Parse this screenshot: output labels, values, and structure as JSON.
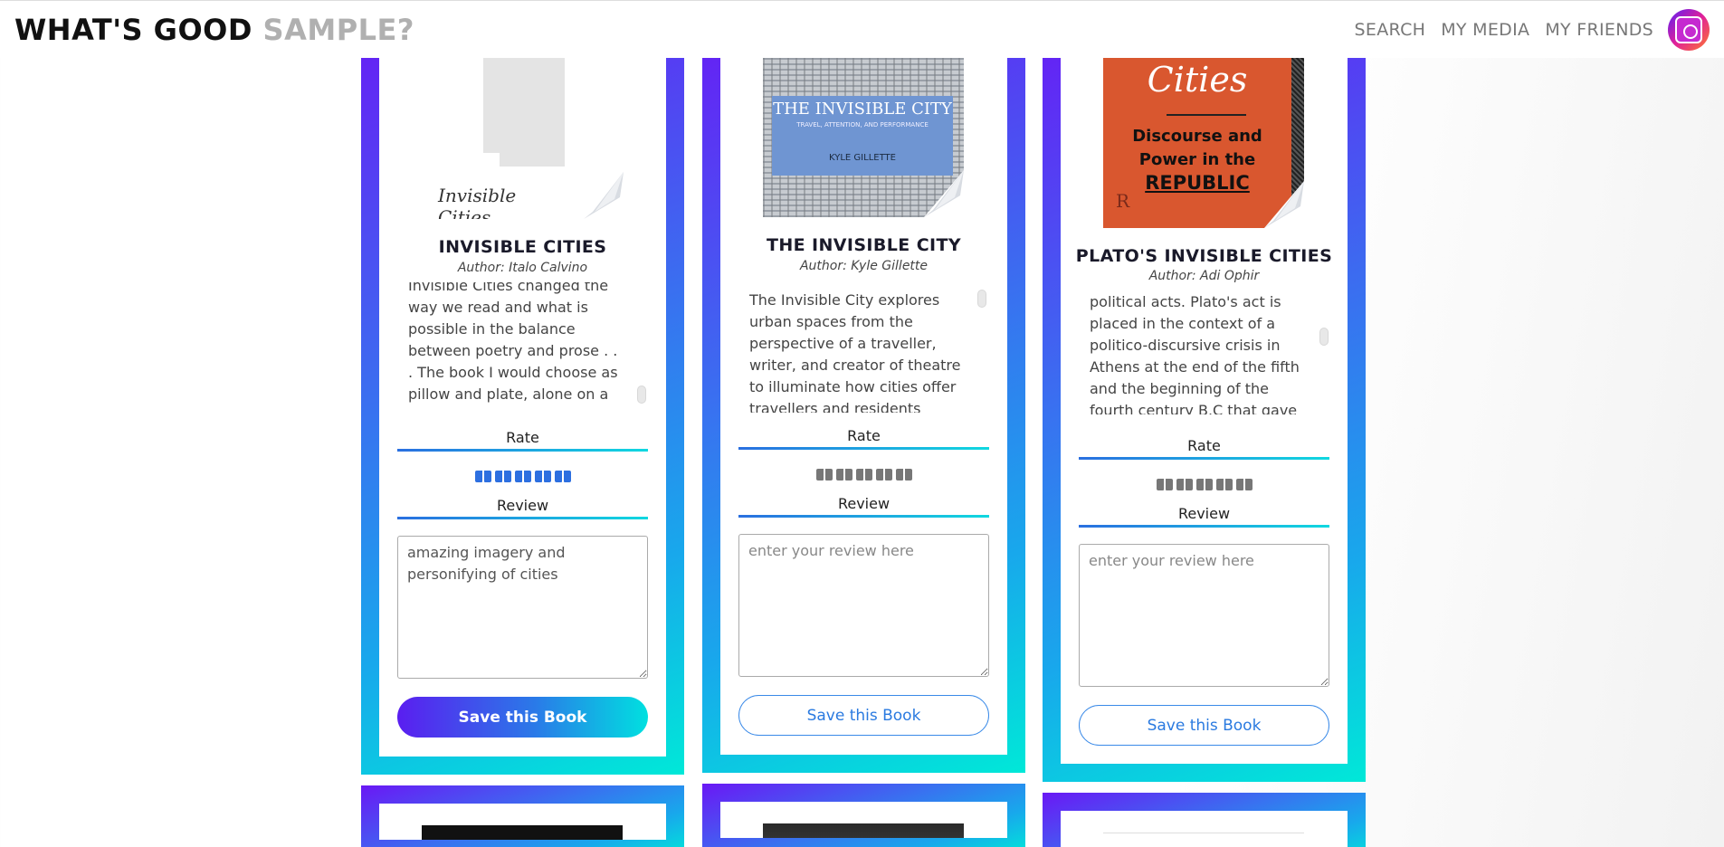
{
  "header": {
    "brand_main": "WHAT'S GOOD",
    "brand_sub": "SAMPLE?",
    "nav": [
      "SEARCH",
      "MY MEDIA",
      "MY FRIENDS"
    ]
  },
  "labels": {
    "rate": "Rate",
    "review": "Review",
    "save": "Save this Book",
    "review_placeholder": "enter your review here"
  },
  "books": [
    {
      "title": "INVISIBLE CITIES",
      "author": "Author: Italo Calvino",
      "description": "Invisible Cities changed the way we read and what is possible in the balance between poetry and prose . . . The book I would choose as pillow and plate, alone on a",
      "rating": 5,
      "review": "amazing imagery and personifying of cities",
      "cover_text": "Invisible Cities"
    },
    {
      "title": "THE INVISIBLE CITY",
      "author": "Author: Kyle Gillette",
      "description": "The Invisible City explores urban spaces from the perspective of a traveller, writer, and creator of theatre to illuminate how cities offer travellers and residents",
      "rating": 0,
      "review": "",
      "cover_title": "THE INVISIBLE CITY",
      "cover_subtitle": "TRAVEL, ATTENTION, AND PERFORMANCE",
      "cover_author": "KYLE GILLETTE"
    },
    {
      "title": "PLATO'S INVISIBLE CITIES",
      "author": "Author: Adi Ophir",
      "description": "political acts. Plato's act is placed in the context of a politico-discursive crisis in Athens at the end of the fifth and the beginning of the fourth century B.C that gave",
      "rating": 0,
      "review": "",
      "cover_word": "Cities",
      "cover_line1": "Discourse and",
      "cover_line2": "Power in the",
      "cover_line3": "REPUBLIC",
      "cover_mark": "R"
    }
  ],
  "colors": {
    "card_gradient_start": "#6a18f5",
    "card_gradient_end": "#00e8d8",
    "link_blue": "#2a7ae0",
    "plato_cover": "#d9572f"
  }
}
